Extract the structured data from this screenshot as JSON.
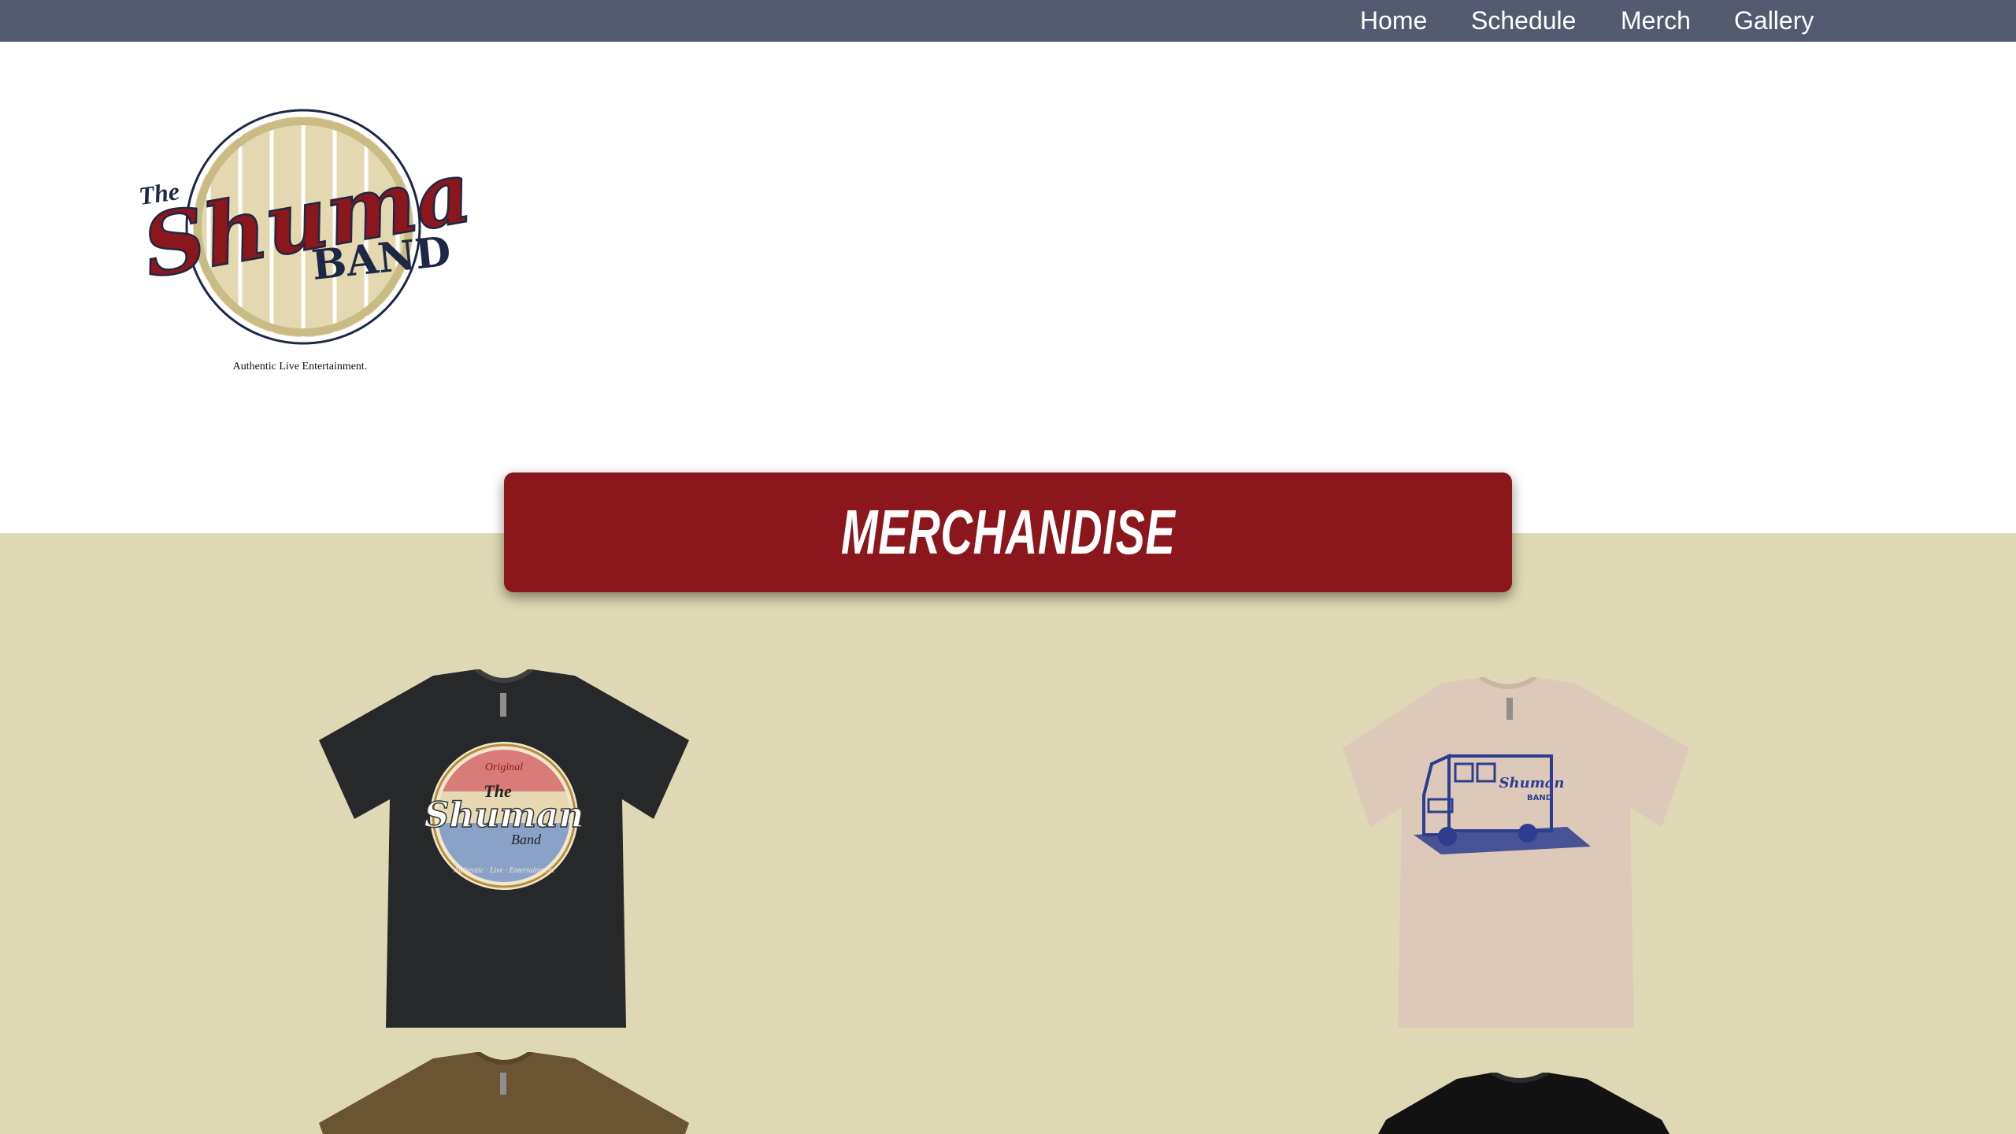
{
  "nav": {
    "items": [
      {
        "label": "Home"
      },
      {
        "label": "Schedule"
      },
      {
        "label": "Merch"
      },
      {
        "label": "Gallery"
      }
    ]
  },
  "logo": {
    "text_the": "The",
    "text_main": "Shuman",
    "text_band": "BAND",
    "tagline": "Authentic Live Entertainment."
  },
  "section": {
    "title": "MERCHANDISE"
  },
  "products": {
    "tee_black_logo": {
      "print_top": "Original",
      "print_the": "The",
      "print_main": "Shuman",
      "print_band": "Band",
      "print_bottom": "Authentic · Live · Entertainment"
    },
    "tee_sand_truck": {
      "print_main": "Shuman",
      "print_band": "BAND"
    }
  },
  "colors": {
    "nav_bg": "#545a70",
    "banner_bg": "#8b161c",
    "band_bg": "#dfd8b4",
    "brand_red": "#8b161c",
    "brand_navy": "#1e2746"
  }
}
